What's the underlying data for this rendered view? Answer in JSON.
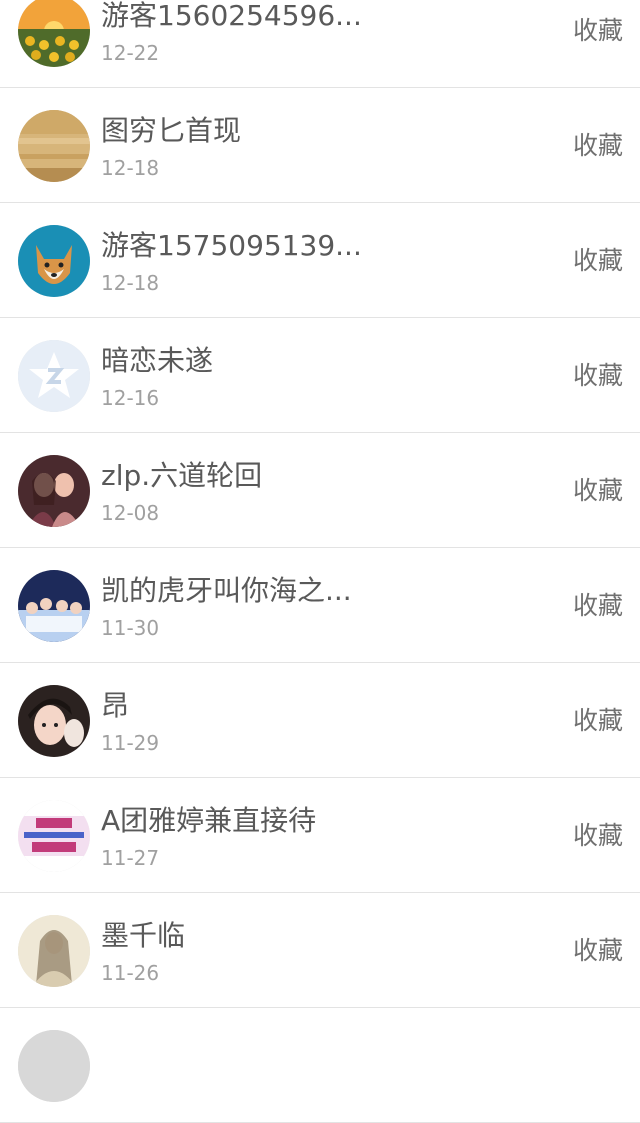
{
  "items": [
    {
      "name": "游客1560254596...",
      "date": "12-22",
      "action": "收藏",
      "avatar": "sunflower-field-avatar"
    },
    {
      "name": "图穷匕首现",
      "date": "12-18",
      "action": "收藏",
      "avatar": "sand-avatar"
    },
    {
      "name": "游客1575095139...",
      "date": "12-18",
      "action": "收藏",
      "avatar": "shiba-dog-avatar"
    },
    {
      "name": "暗恋未遂",
      "date": "12-16",
      "action": "收藏",
      "avatar": "qq-default-avatar"
    },
    {
      "name": "zlp.六道轮回",
      "date": "12-08",
      "action": "收藏",
      "avatar": "two-girls-avatar"
    },
    {
      "name": "凯的虎牙叫你海之...",
      "date": "11-30",
      "action": "收藏",
      "avatar": "group-photo-avatar"
    },
    {
      "name": "昂",
      "date": "11-29",
      "action": "收藏",
      "avatar": "girl-portrait-avatar"
    },
    {
      "name": "A团雅婷兼直接待",
      "date": "11-27",
      "action": "收藏",
      "avatar": "recruitment-ad-avatar"
    },
    {
      "name": "墨千临",
      "date": "11-26",
      "action": "收藏",
      "avatar": "ancient-style-avatar"
    },
    {
      "name": "",
      "date": "",
      "action": "",
      "avatar": "partial-avatar"
    }
  ]
}
